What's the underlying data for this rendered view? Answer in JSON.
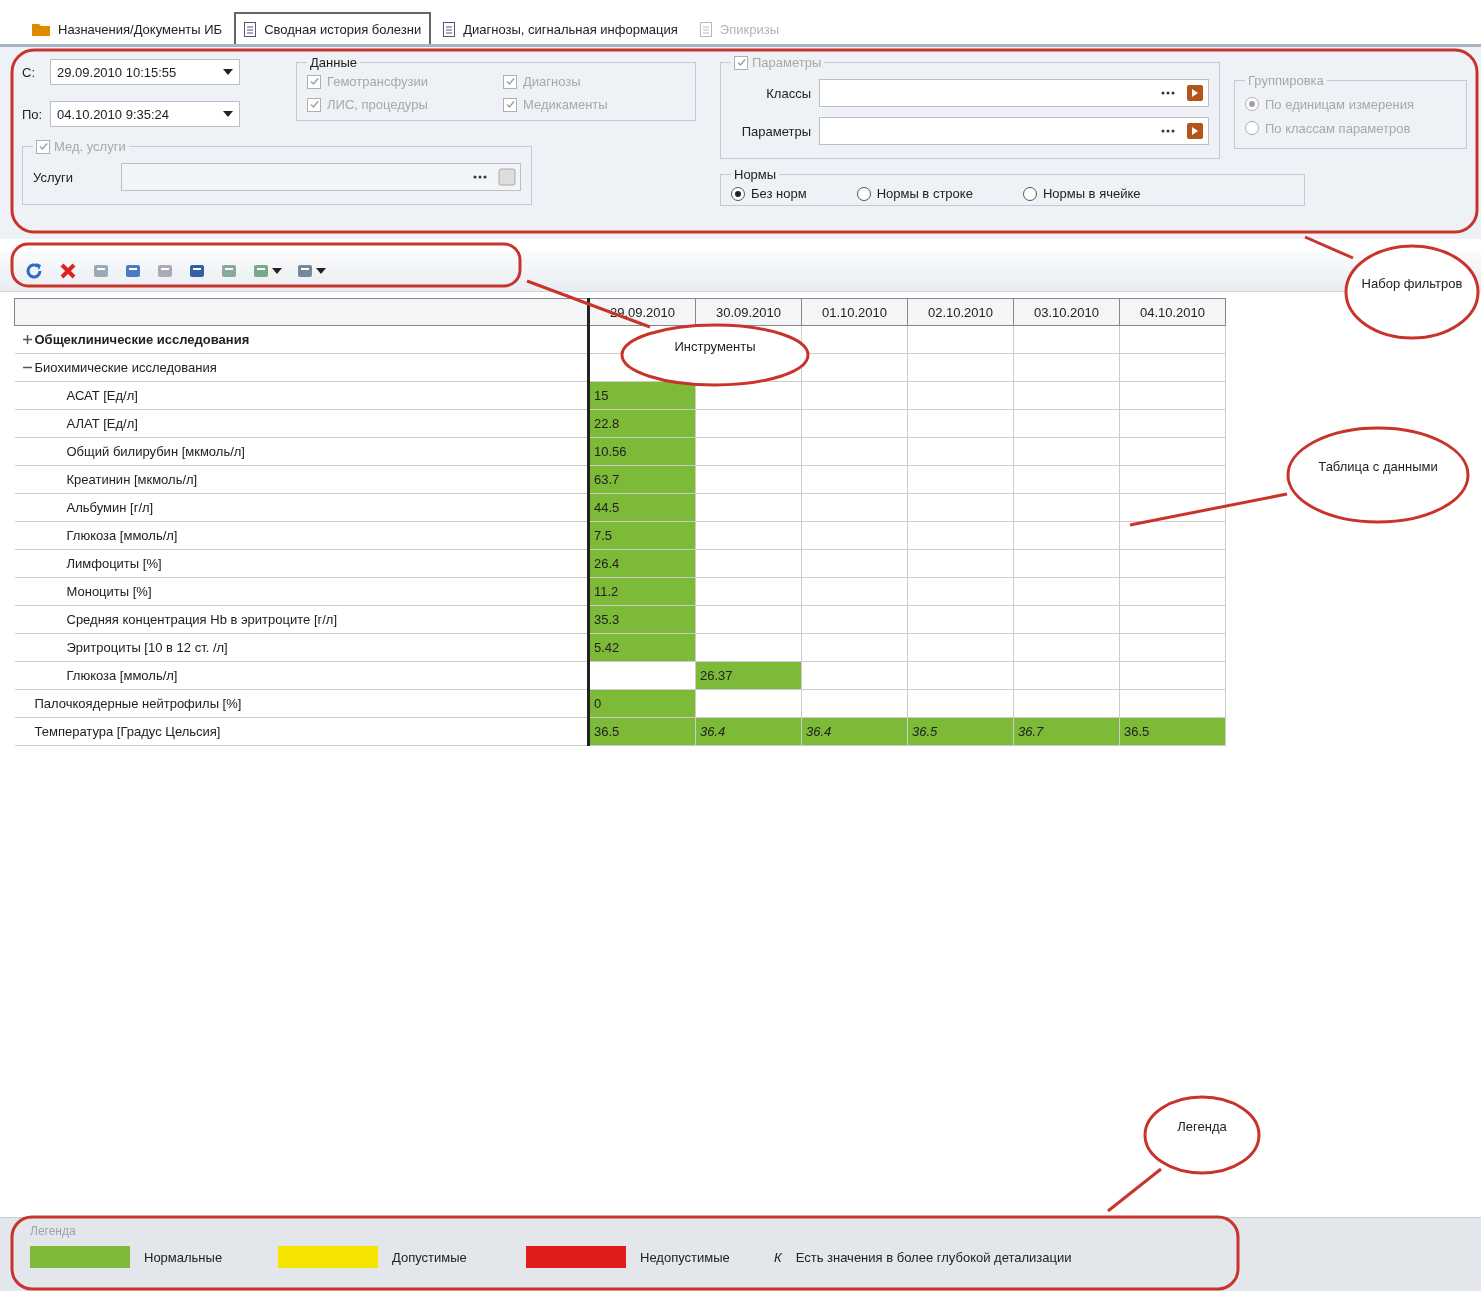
{
  "tabs": [
    {
      "label": "Назначения/Документы ИБ",
      "selected": false,
      "disabled": false
    },
    {
      "label": "Сводная история болезни",
      "selected": true,
      "disabled": false
    },
    {
      "label": "Диагнозы, сигнальная информация",
      "selected": false,
      "disabled": false
    },
    {
      "label": "Эпикризы",
      "selected": false,
      "disabled": true
    }
  ],
  "filters": {
    "from": {
      "label": "С:",
      "value": "29.09.2010 10:15:55"
    },
    "to": {
      "label": "По:",
      "value": "04.10.2010 9:35:24"
    },
    "data_group": {
      "title": "Данные",
      "disabled": true,
      "checks": [
        {
          "label": "Гемотрансфузии",
          "checked": true
        },
        {
          "label": "Диагнозы",
          "checked": true
        },
        {
          "label": "ЛИС, процедуры",
          "checked": true
        },
        {
          "label": "Медикаменты",
          "checked": true
        }
      ]
    },
    "services": {
      "title": "Мед. услуги",
      "checked": true,
      "disabled": true,
      "field_label": "Услуги"
    },
    "params": {
      "title": "Параметры",
      "checked": true,
      "disabled": true,
      "fields": [
        {
          "label": "Классы"
        },
        {
          "label": "Параметры"
        }
      ]
    },
    "grouping": {
      "title": "Группировка",
      "disabled": true,
      "options": [
        {
          "label": "По единицам измерения",
          "selected": true
        },
        {
          "label": "По классам параметров",
          "selected": false
        }
      ]
    },
    "norms": {
      "title": "Нормы",
      "options": [
        {
          "label": "Без норм",
          "selected": true
        },
        {
          "label": "Нормы в строке",
          "selected": false
        },
        {
          "label": "Нормы в ячейке",
          "selected": false
        }
      ]
    }
  },
  "table": {
    "columns": [
      "29.09.2010",
      "30.09.2010",
      "01.10.2010",
      "02.10.2010",
      "03.10.2010",
      "04.10.2010"
    ],
    "rows": [
      {
        "label": "Общеклинические исследования",
        "kind": "group",
        "expanded": false,
        "cells": []
      },
      {
        "label": "Биохимические исследования",
        "kind": "group",
        "expanded": true,
        "cells": [],
        "children": [
          {
            "label": "АСАТ [Ед/л]",
            "kind": "item",
            "cells": [
              {
                "value": "15",
                "normal": true,
                "deeper": false
              }
            ]
          },
          {
            "label": "АЛАТ [Ед/л]",
            "kind": "item",
            "cells": [
              {
                "value": "22.8",
                "normal": true,
                "deeper": false
              }
            ]
          },
          {
            "label": "Общий билирубин [мкмоль/л]",
            "kind": "item",
            "cells": [
              {
                "value": "10.56",
                "normal": true,
                "deeper": false
              }
            ]
          },
          {
            "label": "Креатинин [мкмоль/л]",
            "kind": "item",
            "cells": [
              {
                "value": "63.7",
                "normal": true,
                "deeper": false
              }
            ]
          },
          {
            "label": "Альбумин [г/л]",
            "kind": "item",
            "cells": [
              {
                "value": "44.5",
                "normal": true,
                "deeper": false
              }
            ]
          },
          {
            "label": "Глюкоза [ммоль/л]",
            "kind": "item",
            "cells": [
              {
                "value": "7.5",
                "normal": true,
                "deeper": false
              }
            ]
          },
          {
            "label": "Лимфоциты [%]",
            "kind": "item",
            "cells": [
              {
                "value": "26.4",
                "normal": true,
                "deeper": false
              }
            ]
          },
          {
            "label": "Моноциты [%]",
            "kind": "item",
            "cells": [
              {
                "value": "11.2",
                "normal": true,
                "deeper": false
              }
            ]
          },
          {
            "label": "Средняя концентрация Hb в эритроците [г/л]",
            "kind": "item",
            "cells": [
              {
                "value": "35.3",
                "normal": true,
                "deeper": false
              }
            ]
          },
          {
            "label": "Эритроциты [10 в 12 ст. /л]",
            "kind": "item",
            "cells": [
              {
                "value": "5.42",
                "normal": true,
                "deeper": false
              }
            ]
          },
          {
            "label": "Глюкоза [ммоль/л]",
            "kind": "item",
            "cells": [
              {
                "normal": false
              },
              {
                "value": "26.37",
                "normal": true,
                "deeper": false
              }
            ]
          }
        ]
      },
      {
        "label": "Палочкоядерные нейтрофилы [%]",
        "kind": "item",
        "cells": [
          {
            "value": "0",
            "normal": true,
            "deeper": false
          }
        ]
      },
      {
        "label": "Температура [Градус Цельсия]",
        "kind": "item",
        "cells": [
          {
            "value": "36.5",
            "normal": true,
            "deeper": false
          },
          {
            "value": "36.4",
            "normal": true,
            "deeper": true
          },
          {
            "value": "36.4",
            "normal": true,
            "deeper": true
          },
          {
            "value": "36.5",
            "normal": true,
            "deeper": true
          },
          {
            "value": "36.7",
            "normal": true,
            "deeper": true
          },
          {
            "value": "36.5",
            "normal": true,
            "deeper": false
          }
        ]
      }
    ]
  },
  "legend": {
    "title": "Легенда",
    "items": [
      {
        "label": "Нормальные",
        "color": "#7dba38"
      },
      {
        "label": "Допустимые",
        "color": "#f5e400"
      },
      {
        "label": "Недопустимые",
        "color": "#e01c1c"
      }
    ],
    "marker": {
      "symbol": "К",
      "label": "Есть значения в более глубокой детализации"
    }
  },
  "annotations": [
    {
      "label": "Набор фильтров"
    },
    {
      "label": "Инструменты"
    },
    {
      "label": "Таблица с данными"
    },
    {
      "label": "Легенда"
    }
  ]
}
